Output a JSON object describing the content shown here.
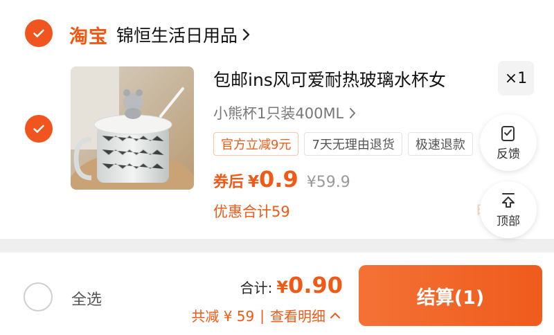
{
  "shop": {
    "logo": "淘宝",
    "name": "锦恒生活日用品"
  },
  "item": {
    "title": "包邮ins风可爱耐热玻璃水杯女",
    "quantity": "×1",
    "spec": "小熊杯1只装400ML",
    "tags": [
      "官方立减9元",
      "7天无理由退货",
      "极速退款"
    ],
    "price_label": "券后",
    "currency": "¥",
    "price": "0.9",
    "original_price": "¥59.9",
    "discount_text": "优惠合计59",
    "ghost_detail": "明细"
  },
  "float_buttons": {
    "feedback": "反馈",
    "top": "顶部"
  },
  "bottom_bar": {
    "select_all": "全选",
    "total_label": "合计:",
    "total_currency": "¥",
    "total_amount": "0.90",
    "saving_text": "共减 ¥ 59",
    "separator": "|",
    "detail_link": "查看明细",
    "checkout_label": "结算(1)"
  },
  "colors": {
    "accent": "#f05a16",
    "checkbox": "#f0541f"
  }
}
